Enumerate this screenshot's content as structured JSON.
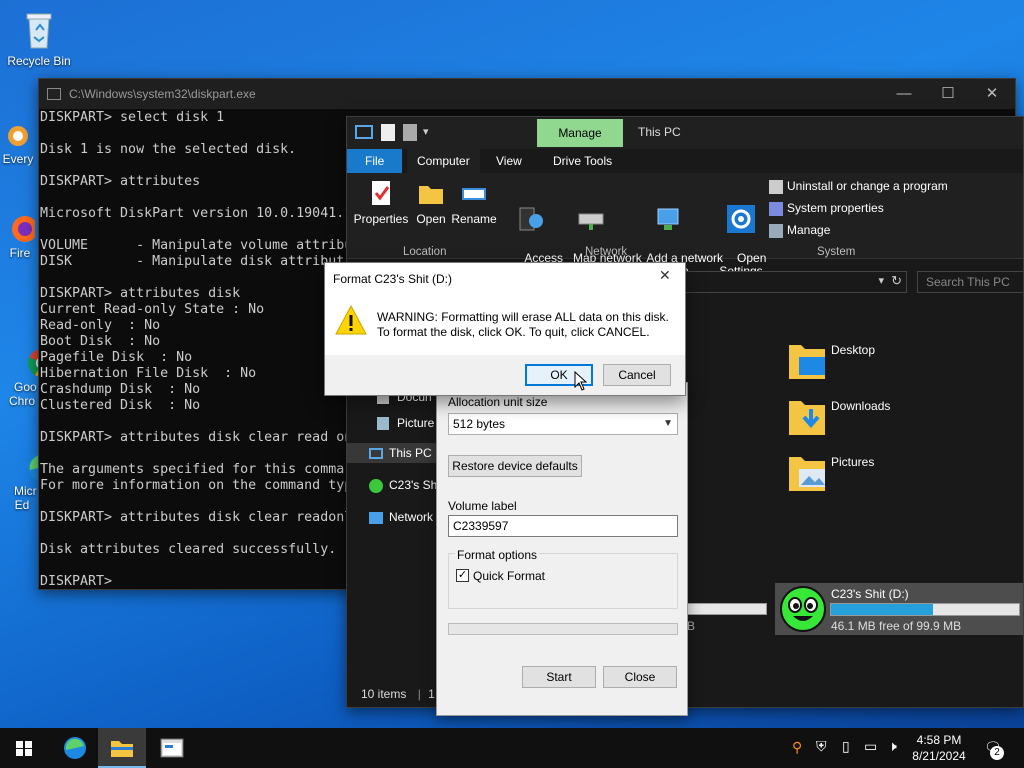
{
  "desktop": {
    "icons": [
      {
        "label": "Recycle Bin",
        "icon": "recycle-bin-icon"
      },
      {
        "label": "Every",
        "icon": "everything-icon"
      },
      {
        "label": "Fire",
        "icon": "firefox-icon"
      },
      {
        "label": "Goo\nChro",
        "icon": "chrome-icon"
      },
      {
        "label": "Micr\nEd",
        "icon": "edge-icon"
      }
    ]
  },
  "console": {
    "title": "C:\\Windows\\system32\\diskpart.exe",
    "controls": {
      "minimize": "—",
      "maximize": "☐",
      "close": "✕"
    },
    "lines": [
      "DISKPART> select disk 1",
      "",
      "Disk 1 is now the selected disk.",
      "",
      "DISKPART> attributes",
      "",
      "Microsoft DiskPart version 10.0.19041.1",
      "",
      "VOLUME      - Manipulate volume attribu",
      "DISK        - Manipulate disk attribut",
      "",
      "DISKPART> attributes disk",
      "Current Read-only State : No",
      "Read-only  : No",
      "Boot Disk  : No",
      "Pagefile Disk  : No",
      "Hibernation File Disk  : No",
      "Crashdump Disk  : No",
      "Clustered Disk  : No",
      "",
      "DISKPART> attributes disk clear read on",
      "",
      "The arguments specified for this comma",
      "For more information on the command typ",
      "",
      "DISKPART> attributes disk clear readonl",
      "",
      "Disk attributes cleared successfully.",
      "",
      "DISKPART>"
    ]
  },
  "explorer": {
    "context_tab": "Manage",
    "window_title": "This PC",
    "tabs": [
      "File",
      "Computer",
      "View",
      "Drive Tools"
    ],
    "ribbon": {
      "properties": "Properties",
      "open": "Open",
      "rename": "Rename",
      "access_media": "Access\nmedia ▾",
      "map_drive": "Map network\ndrive ▾",
      "add_location": "Add a network\nlocation",
      "open_settings": "Open\nSettings",
      "uninstall": "Uninstall or change a program",
      "system_props": "System properties",
      "manage": "Manage",
      "group_location": "Location",
      "group_network": "Network",
      "group_system": "System"
    },
    "search_placeholder": "Search This PC",
    "nav": {
      "documents": "Docun",
      "pictures": "Picture",
      "this_pc": "This PC",
      "drive": "C23's Sh",
      "network": "Network"
    },
    "folders": [
      "Desktop",
      "Downloads",
      "Pictures"
    ],
    "partial_drive_text": "B",
    "drive": {
      "name": "C23's Shit (D:)",
      "free": "46.1 MB free of 99.9 MB",
      "used_fraction": 0.54
    },
    "status": "10 items",
    "status_sep": "1 i"
  },
  "format_dialog": {
    "alloc_label": "Allocation unit size",
    "alloc_value": "512 bytes",
    "restore_label": "Restore device defaults",
    "volume_label_caption": "Volume label",
    "volume_label_value": "C2339597",
    "options_caption": "Format options",
    "quick_format": "Quick Format",
    "start": "Start",
    "close": "Close"
  },
  "warning_dialog": {
    "title": "Format C23's Shit (D:)",
    "line1": "WARNING: Formatting will erase ALL data on this disk.",
    "line2": "To format the disk, click OK. To quit, click CANCEL.",
    "ok": "OK",
    "cancel": "Cancel",
    "close_glyph": "✕"
  },
  "taskbar": {
    "time": "4:58 PM",
    "date": "8/21/2024",
    "notification_count": "2"
  },
  "colors": {
    "accent": "#0078d7",
    "manage_tab": "#90d890",
    "drive_bar": "#26a0da"
  }
}
